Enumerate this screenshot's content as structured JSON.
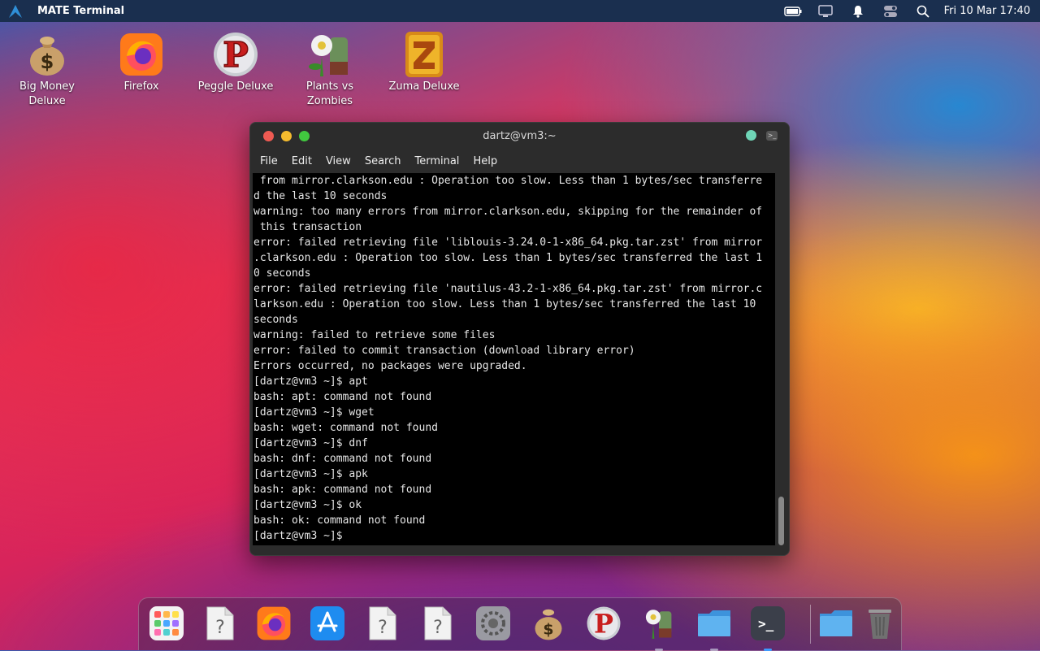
{
  "panel": {
    "app_title": "MATE Terminal",
    "clock": "Fri 10 Mar 17:40",
    "tray_icons": [
      "battery-icon",
      "display-icon",
      "notification-bell-icon",
      "toggle-switch-icon",
      "search-icon"
    ]
  },
  "desktop": {
    "icons": [
      {
        "label": "Big Money Deluxe",
        "icon": "money-bag-icon"
      },
      {
        "label": "Firefox",
        "icon": "firefox-icon"
      },
      {
        "label": "Peggle Deluxe",
        "icon": "peggle-icon"
      },
      {
        "label": "Plants vs Zombies",
        "icon": "plants-vs-zombies-icon"
      },
      {
        "label": "Zuma Deluxe",
        "icon": "zuma-icon"
      }
    ]
  },
  "terminal": {
    "title": "dartz@vm3:~",
    "menu": [
      "File",
      "Edit",
      "View",
      "Search",
      "Terminal",
      "Help"
    ],
    "lines": [
      " from mirror.clarkson.edu : Operation too slow. Less than 1 bytes/sec transferre",
      "d the last 10 seconds",
      "warning: too many errors from mirror.clarkson.edu, skipping for the remainder of",
      " this transaction",
      "error: failed retrieving file 'liblouis-3.24.0-1-x86_64.pkg.tar.zst' from mirror",
      ".clarkson.edu : Operation too slow. Less than 1 bytes/sec transferred the last 1",
      "0 seconds",
      "error: failed retrieving file 'nautilus-43.2-1-x86_64.pkg.tar.zst' from mirror.c",
      "larkson.edu : Operation too slow. Less than 1 bytes/sec transferred the last 10",
      "seconds",
      "warning: failed to retrieve some files",
      "error: failed to commit transaction (download library error)",
      "Errors occurred, no packages were upgraded.",
      "[dartz@vm3 ~]$ apt",
      "bash: apt: command not found",
      "[dartz@vm3 ~]$ wget",
      "bash: wget: command not found",
      "[dartz@vm3 ~]$ dnf",
      "bash: dnf: command not found",
      "[dartz@vm3 ~]$ apk",
      "bash: apk: command not found",
      "[dartz@vm3 ~]$ ok",
      "bash: ok: command not found",
      "[dartz@vm3 ~]$ "
    ]
  },
  "dock": {
    "items": [
      {
        "name": "app-grid-icon",
        "running": false
      },
      {
        "name": "unknown-file-icon",
        "running": false
      },
      {
        "name": "firefox-icon",
        "running": false
      },
      {
        "name": "app-store-icon",
        "running": false
      },
      {
        "name": "unknown-file-icon",
        "running": false
      },
      {
        "name": "unknown-file-icon",
        "running": false
      },
      {
        "name": "settings-icon",
        "running": false
      },
      {
        "name": "money-bag-icon",
        "running": false
      },
      {
        "name": "peggle-icon",
        "running": false
      },
      {
        "name": "plants-vs-zombies-icon",
        "running": true
      },
      {
        "name": "folder-icon",
        "running": true
      },
      {
        "name": "terminal-icon",
        "running": true
      },
      {
        "name": "folder-icon",
        "running": false
      },
      {
        "name": "trash-icon",
        "running": false
      }
    ],
    "terminal_prompt_glyph": ">_"
  }
}
